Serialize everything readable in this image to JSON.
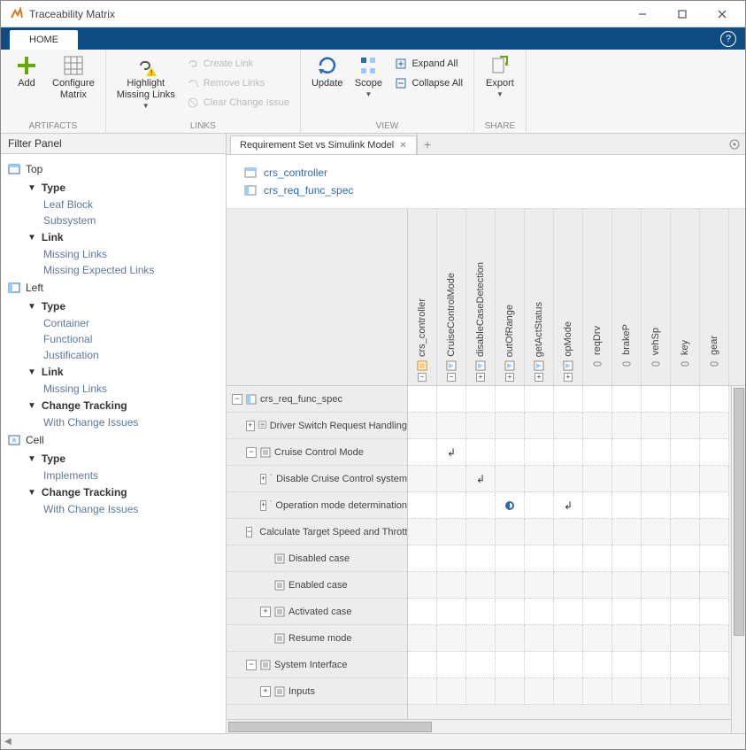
{
  "window": {
    "title": "Traceability Matrix"
  },
  "tabs": {
    "home": "HOME"
  },
  "ribbon": {
    "artifacts": {
      "label": "ARTIFACTS",
      "add": "Add",
      "configure": "Configure\nMatrix"
    },
    "links": {
      "label": "LINKS",
      "highlight": "Highlight\nMissing Links",
      "create": "Create Link",
      "remove": "Remove Links",
      "clear": "Clear Change Issue"
    },
    "view": {
      "label": "VIEW",
      "update": "Update",
      "scope": "Scope",
      "expand": "Expand All",
      "collapse": "Collapse All"
    },
    "share": {
      "label": "SHARE",
      "export": "Export"
    }
  },
  "filter": {
    "title": "Filter Panel",
    "top": "Top",
    "left": "Left",
    "cell": "Cell",
    "type": "Type",
    "link": "Link",
    "change_tracking": "Change Tracking",
    "top_type": {
      "leaf_block": "Leaf Block",
      "subsystem": "Subsystem"
    },
    "top_link": {
      "missing": "Missing Links",
      "missing_expected": "Missing Expected Links"
    },
    "left_type": {
      "container": "Container",
      "functional": "Functional",
      "justification": "Justification"
    },
    "left_link": {
      "missing": "Missing Links"
    },
    "left_ct": {
      "wci": "With Change Issues"
    },
    "cell_type": {
      "implements": "Implements"
    },
    "cell_ct": {
      "wci": "With Change Issues"
    }
  },
  "doc_tab": {
    "name": "Requirement Set vs Simulink Model"
  },
  "artifacts_list": {
    "controller": "crs_controller",
    "req": "crs_req_func_spec"
  },
  "matrix": {
    "cols": [
      {
        "label": "crs_controller",
        "expand": "-",
        "icon": "model"
      },
      {
        "label": "CruiseControlMode",
        "expand": "-",
        "icon": "sub"
      },
      {
        "label": "disableCaseDetection",
        "expand": "+",
        "icon": "sub"
      },
      {
        "label": "outOfRange",
        "expand": "+",
        "icon": "sub"
      },
      {
        "label": "getActStatus",
        "expand": "+",
        "icon": "sub"
      },
      {
        "label": "opMode",
        "expand": "+",
        "icon": "sub"
      },
      {
        "label": "reqDrv",
        "expand": "",
        "icon": "port"
      },
      {
        "label": "brakeP",
        "expand": "",
        "icon": "port"
      },
      {
        "label": "vehSp",
        "expand": "",
        "icon": "port"
      },
      {
        "label": "key",
        "expand": "",
        "icon": "port"
      },
      {
        "label": "gear",
        "expand": "",
        "icon": "port"
      }
    ],
    "rows": [
      {
        "indent": 0,
        "expand": "-",
        "label": "crs_req_func_spec",
        "icon": "spec"
      },
      {
        "indent": 1,
        "expand": "+",
        "label": "Driver Switch Request Handling",
        "icon": "req"
      },
      {
        "indent": 1,
        "expand": "-",
        "label": "Cruise Control Mode",
        "icon": "req",
        "cells": {
          "1": "arrow"
        }
      },
      {
        "indent": 2,
        "expand": "+",
        "label": "Disable Cruise Control system",
        "icon": "req",
        "cells": {
          "2": "arrow"
        }
      },
      {
        "indent": 2,
        "expand": "+",
        "label": "Operation mode determination",
        "icon": "req",
        "cells": {
          "3": "circle",
          "5": "arrow"
        }
      },
      {
        "indent": 1,
        "expand": "-",
        "label": "Calculate Target Speed and Throttle",
        "icon": "req"
      },
      {
        "indent": 2,
        "expand": "",
        "label": "Disabled case",
        "icon": "req"
      },
      {
        "indent": 2,
        "expand": "",
        "label": "Enabled case",
        "icon": "req"
      },
      {
        "indent": 2,
        "expand": "+",
        "label": "Activated case",
        "icon": "req"
      },
      {
        "indent": 2,
        "expand": "",
        "label": "Resume mode",
        "icon": "req"
      },
      {
        "indent": 1,
        "expand": "-",
        "label": "System Interface",
        "icon": "req"
      },
      {
        "indent": 2,
        "expand": "+",
        "label": "Inputs",
        "icon": "req"
      }
    ]
  }
}
